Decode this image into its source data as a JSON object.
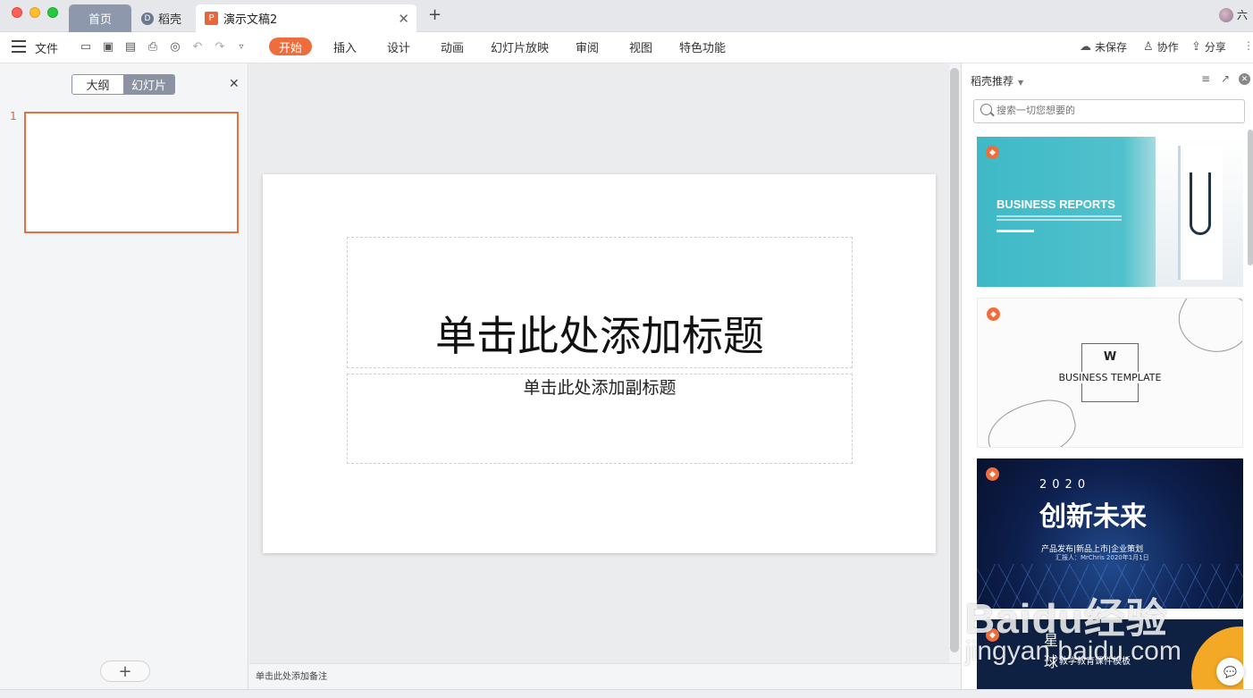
{
  "titlebar": {
    "tabs": [
      {
        "label": "首页"
      },
      {
        "label": "稻壳"
      },
      {
        "label": "演示文稿2"
      }
    ],
    "user_name": "六"
  },
  "toolbar": {
    "file_label": "文件",
    "ribbon_tabs": [
      "开始",
      "插入",
      "设计",
      "动画",
      "幻灯片放映",
      "审阅",
      "视图",
      "特色功能"
    ],
    "actions": {
      "unsaved": "未保存",
      "collaborate": "协作",
      "share": "分享"
    }
  },
  "left_panel": {
    "tabs": [
      "大纲",
      "幻灯片"
    ],
    "slide_number": "1"
  },
  "slide": {
    "title_placeholder": "单击此处添加标题",
    "subtitle_placeholder": "单击此处添加副标题"
  },
  "notes_placeholder": "单击此处添加备注",
  "right_panel": {
    "title": "稻壳推荐",
    "search_placeholder": "搜索一切您想要的",
    "templates": [
      {
        "heading": "BUSINESS REPORTS"
      },
      {
        "logo": "W",
        "heading": "BUSINESS TEMPLATE"
      },
      {
        "year": "2020",
        "heading": "创新未来",
        "subtitle": "产品发布|新品上市|企业策划",
        "reporter": "汇报人：MrChris    2020年1月1日"
      },
      {
        "heading_a": "星",
        "heading_b": "球",
        "subtitle": "教学教育课件模板"
      }
    ]
  },
  "watermark": {
    "line1": "Baidu经验",
    "line2": "jingyan.baidu.com"
  }
}
